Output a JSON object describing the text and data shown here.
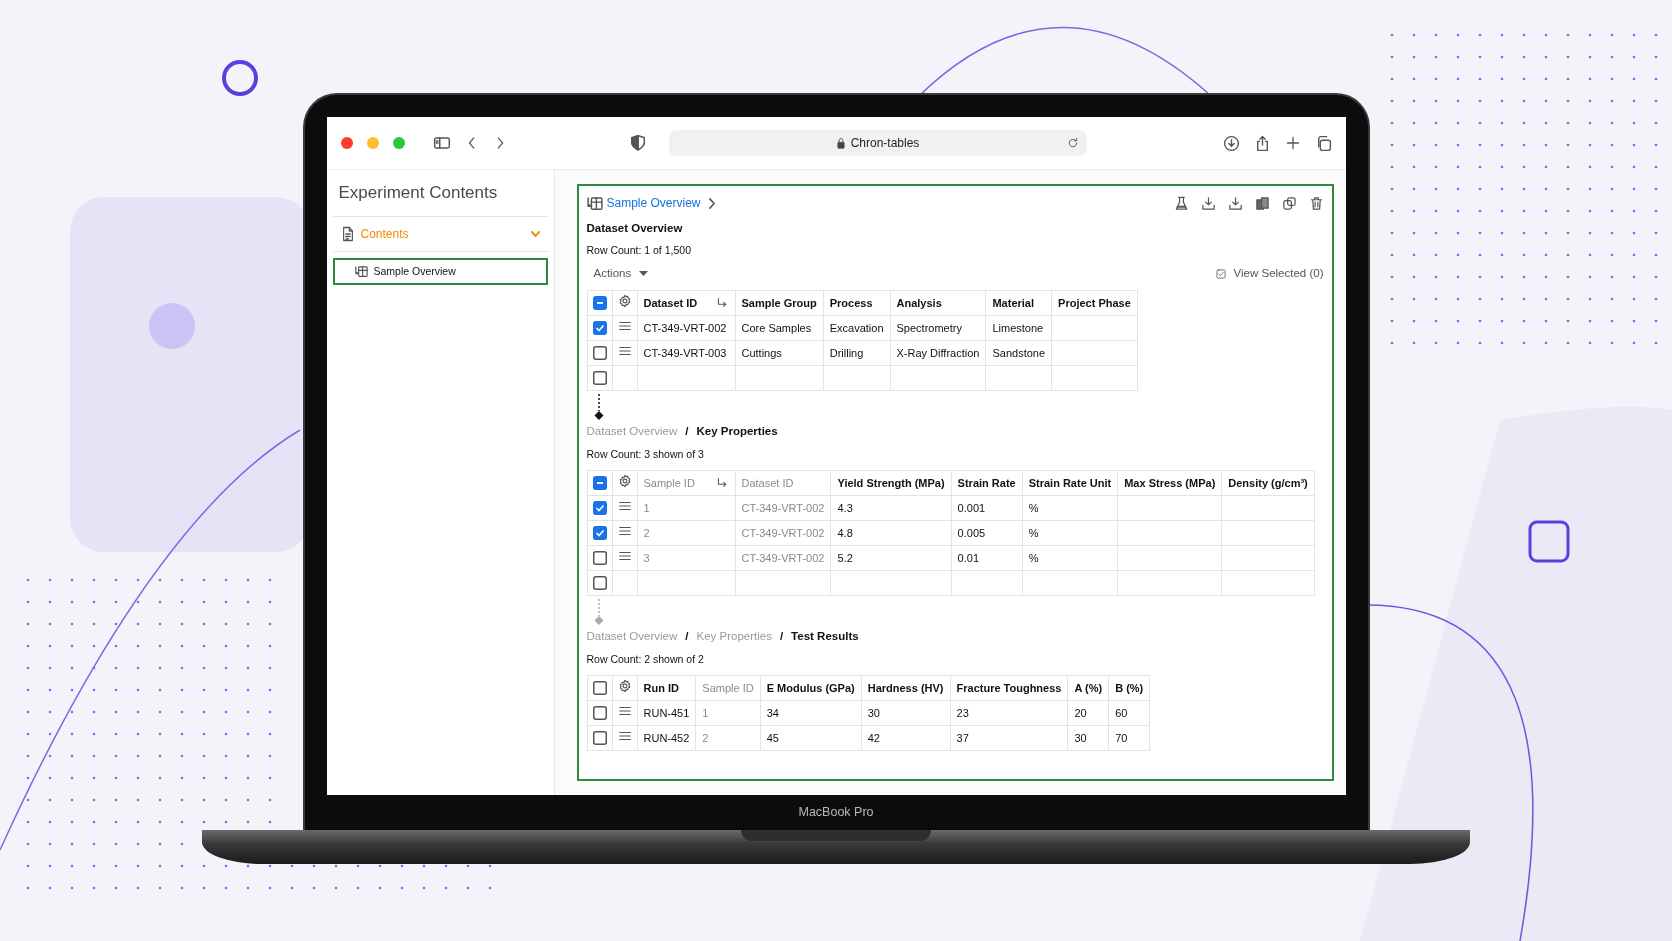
{
  "browser": {
    "url": "Chron-tables"
  },
  "sidebar": {
    "title": "Experiment Contents",
    "section": {
      "label": "Contents",
      "expanded": true
    },
    "items": [
      {
        "label": "Sample Overview",
        "selected": true
      }
    ]
  },
  "panel": {
    "title": "Sample Overview",
    "sections": [
      {
        "breadcrumb": [
          {
            "label": "Dataset Overview",
            "current": true
          }
        ],
        "row_count": "Row Count: 1 of 1,500",
        "actions": "Actions",
        "view_selected": "View Selected (0)",
        "header_partial": true,
        "columns": [
          {
            "label": "Dataset ID",
            "muted": false,
            "link": true
          },
          {
            "label": "Sample Group",
            "muted": false,
            "link": false
          },
          {
            "label": "Process",
            "muted": false,
            "link": false
          },
          {
            "label": "Analysis",
            "muted": false,
            "link": false
          },
          {
            "label": "Material",
            "muted": false,
            "link": false
          },
          {
            "label": "Project Phase",
            "muted": false,
            "link": false
          }
        ],
        "rows": [
          {
            "kind": "data",
            "checked": true,
            "cells": [
              "CT-349-VRT-002",
              "Core Samples",
              "Excavation",
              "Spectrometry",
              "Limestone"
            ]
          },
          {
            "kind": "data",
            "checked": false,
            "cells": [
              "CT-349-VRT-003",
              "Cuttings",
              "Drilling",
              "X-Ray Diffraction",
              "Sandstone"
            ]
          },
          {
            "kind": "blank",
            "checked": false
          }
        ]
      },
      {
        "connector_active": true,
        "separator": "/",
        "breadcrumb": [
          {
            "label": "Dataset Overview",
            "current": false
          },
          {
            "label": "Key Properties",
            "current": true
          }
        ],
        "row_count": "Row Count: 3 shown of 3",
        "header_partial": true,
        "columns": [
          {
            "label": "Sample ID",
            "muted": true,
            "link": true
          },
          {
            "label": "Dataset ID",
            "muted": true,
            "link": false
          },
          {
            "label": "Yield Strength (MPa)",
            "muted": false,
            "link": false
          },
          {
            "label": "Strain Rate",
            "muted": false,
            "link": false
          },
          {
            "label": "Strain Rate Unit",
            "muted": false,
            "link": false
          },
          {
            "label": "Max Stress (MPa)",
            "muted": false,
            "link": false
          },
          {
            "label": "Density (g/cm³)",
            "muted": false,
            "link": false
          }
        ],
        "rows": [
          {
            "kind": "data",
            "checked": true,
            "cells": [
              "1",
              "CT-349-VRT-002",
              "4.3",
              "0.001",
              "%"
            ]
          },
          {
            "kind": "data",
            "checked": true,
            "cells": [
              "2",
              "CT-349-VRT-002",
              "4.8",
              "0.005",
              "%"
            ]
          },
          {
            "kind": "data",
            "checked": false,
            "cells": [
              "3",
              "CT-349-VRT-002",
              "5.2",
              "0.01",
              "%"
            ]
          },
          {
            "kind": "blank",
            "checked": false
          }
        ]
      },
      {
        "connector_active": false,
        "separator": "/",
        "breadcrumb": [
          {
            "label": "Dataset Overview",
            "current": false
          },
          {
            "label": "Key Properties",
            "current": false
          },
          {
            "label": "Test Results",
            "current": true
          }
        ],
        "row_count": "Row Count: 2 shown of 2",
        "header_partial": false,
        "columns": [
          {
            "label": "Run ID",
            "muted": false,
            "link": false
          },
          {
            "label": "Sample ID",
            "muted": true,
            "link": false
          },
          {
            "label": "E Modulus (GPa)",
            "muted": false,
            "link": false
          },
          {
            "label": "Hardness (HV)",
            "muted": false,
            "link": false
          },
          {
            "label": "Fracture Toughness",
            "muted": false,
            "link": false
          },
          {
            "label": "A (%)",
            "muted": false,
            "link": false
          },
          {
            "label": "B (%)",
            "muted": false,
            "link": false
          }
        ],
        "rows": [
          {
            "kind": "data",
            "checked": false,
            "cells": [
              "RUN-451",
              "1",
              "34",
              "30",
              "23",
              "20",
              "60"
            ]
          },
          {
            "kind": "data",
            "checked": false,
            "cells": [
              "RUN-452",
              "2",
              "45",
              "42",
              "37",
              "30",
              "70"
            ]
          }
        ]
      }
    ]
  },
  "laptop_label": "MacBook Pro"
}
